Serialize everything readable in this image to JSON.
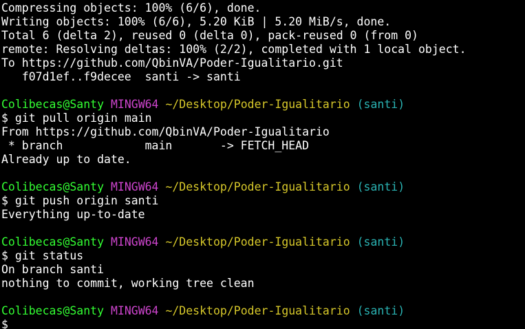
{
  "terminal": {
    "colors": {
      "background": "#000000",
      "text": "#ffffff",
      "user": "#33ff33",
      "system": "#cc44cc",
      "path": "#d7c82a",
      "branch": "#2ab4b4"
    },
    "push_output": [
      "Compressing objects: 100% (6/6), done.",
      "Writing objects: 100% (6/6), 5.20 KiB | 5.20 MiB/s, done.",
      "Total 6 (delta 2), reused 0 (delta 0), pack-reused 0 (from 0)",
      "remote: Resolving deltas: 100% (2/2), completed with 1 local object.",
      "To https://github.com/QbinVA/Poder-Igualitario.git",
      "   f07d1ef..f9decee  santi -> santi"
    ],
    "prompt": {
      "user": "Colibecas@Santy",
      "system": "MINGW64",
      "path": "~/Desktop/Poder-Igualitario",
      "branch": "(santi)",
      "symbol": "$"
    },
    "blocks": [
      {
        "command": "git pull origin main",
        "output": [
          "From https://github.com/QbinVA/Poder-Igualitario",
          " * branch            main       -> FETCH_HEAD",
          "Already up to date."
        ]
      },
      {
        "command": "git push origin santi",
        "output": [
          "Everything up-to-date"
        ]
      },
      {
        "command": "git status",
        "output": [
          "On branch santi",
          "nothing to commit, working tree clean"
        ]
      }
    ]
  }
}
